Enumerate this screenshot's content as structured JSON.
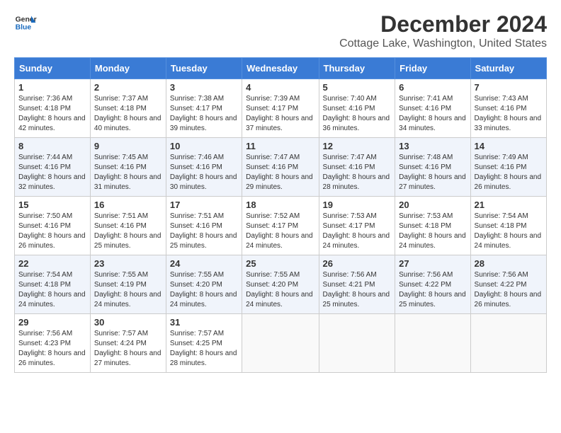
{
  "logo": {
    "line1": "General",
    "line2": "Blue"
  },
  "title": "December 2024",
  "subtitle": "Cottage Lake, Washington, United States",
  "header_color": "#3a7bd5",
  "days": [
    "Sunday",
    "Monday",
    "Tuesday",
    "Wednesday",
    "Thursday",
    "Friday",
    "Saturday"
  ],
  "weeks": [
    [
      {
        "day": "1",
        "sunrise": "7:36 AM",
        "sunset": "4:18 PM",
        "daylight": "8 hours and 42 minutes."
      },
      {
        "day": "2",
        "sunrise": "7:37 AM",
        "sunset": "4:18 PM",
        "daylight": "8 hours and 40 minutes."
      },
      {
        "day": "3",
        "sunrise": "7:38 AM",
        "sunset": "4:17 PM",
        "daylight": "8 hours and 39 minutes."
      },
      {
        "day": "4",
        "sunrise": "7:39 AM",
        "sunset": "4:17 PM",
        "daylight": "8 hours and 37 minutes."
      },
      {
        "day": "5",
        "sunrise": "7:40 AM",
        "sunset": "4:16 PM",
        "daylight": "8 hours and 36 minutes."
      },
      {
        "day": "6",
        "sunrise": "7:41 AM",
        "sunset": "4:16 PM",
        "daylight": "8 hours and 34 minutes."
      },
      {
        "day": "7",
        "sunrise": "7:43 AM",
        "sunset": "4:16 PM",
        "daylight": "8 hours and 33 minutes."
      }
    ],
    [
      {
        "day": "8",
        "sunrise": "7:44 AM",
        "sunset": "4:16 PM",
        "daylight": "8 hours and 32 minutes."
      },
      {
        "day": "9",
        "sunrise": "7:45 AM",
        "sunset": "4:16 PM",
        "daylight": "8 hours and 31 minutes."
      },
      {
        "day": "10",
        "sunrise": "7:46 AM",
        "sunset": "4:16 PM",
        "daylight": "8 hours and 30 minutes."
      },
      {
        "day": "11",
        "sunrise": "7:47 AM",
        "sunset": "4:16 PM",
        "daylight": "8 hours and 29 minutes."
      },
      {
        "day": "12",
        "sunrise": "7:47 AM",
        "sunset": "4:16 PM",
        "daylight": "8 hours and 28 minutes."
      },
      {
        "day": "13",
        "sunrise": "7:48 AM",
        "sunset": "4:16 PM",
        "daylight": "8 hours and 27 minutes."
      },
      {
        "day": "14",
        "sunrise": "7:49 AM",
        "sunset": "4:16 PM",
        "daylight": "8 hours and 26 minutes."
      }
    ],
    [
      {
        "day": "15",
        "sunrise": "7:50 AM",
        "sunset": "4:16 PM",
        "daylight": "8 hours and 26 minutes."
      },
      {
        "day": "16",
        "sunrise": "7:51 AM",
        "sunset": "4:16 PM",
        "daylight": "8 hours and 25 minutes."
      },
      {
        "day": "17",
        "sunrise": "7:51 AM",
        "sunset": "4:16 PM",
        "daylight": "8 hours and 25 minutes."
      },
      {
        "day": "18",
        "sunrise": "7:52 AM",
        "sunset": "4:17 PM",
        "daylight": "8 hours and 24 minutes."
      },
      {
        "day": "19",
        "sunrise": "7:53 AM",
        "sunset": "4:17 PM",
        "daylight": "8 hours and 24 minutes."
      },
      {
        "day": "20",
        "sunrise": "7:53 AM",
        "sunset": "4:18 PM",
        "daylight": "8 hours and 24 minutes."
      },
      {
        "day": "21",
        "sunrise": "7:54 AM",
        "sunset": "4:18 PM",
        "daylight": "8 hours and 24 minutes."
      }
    ],
    [
      {
        "day": "22",
        "sunrise": "7:54 AM",
        "sunset": "4:18 PM",
        "daylight": "8 hours and 24 minutes."
      },
      {
        "day": "23",
        "sunrise": "7:55 AM",
        "sunset": "4:19 PM",
        "daylight": "8 hours and 24 minutes."
      },
      {
        "day": "24",
        "sunrise": "7:55 AM",
        "sunset": "4:20 PM",
        "daylight": "8 hours and 24 minutes."
      },
      {
        "day": "25",
        "sunrise": "7:55 AM",
        "sunset": "4:20 PM",
        "daylight": "8 hours and 24 minutes."
      },
      {
        "day": "26",
        "sunrise": "7:56 AM",
        "sunset": "4:21 PM",
        "daylight": "8 hours and 25 minutes."
      },
      {
        "day": "27",
        "sunrise": "7:56 AM",
        "sunset": "4:22 PM",
        "daylight": "8 hours and 25 minutes."
      },
      {
        "day": "28",
        "sunrise": "7:56 AM",
        "sunset": "4:22 PM",
        "daylight": "8 hours and 26 minutes."
      }
    ],
    [
      {
        "day": "29",
        "sunrise": "7:56 AM",
        "sunset": "4:23 PM",
        "daylight": "8 hours and 26 minutes."
      },
      {
        "day": "30",
        "sunrise": "7:57 AM",
        "sunset": "4:24 PM",
        "daylight": "8 hours and 27 minutes."
      },
      {
        "day": "31",
        "sunrise": "7:57 AM",
        "sunset": "4:25 PM",
        "daylight": "8 hours and 28 minutes."
      },
      null,
      null,
      null,
      null
    ]
  ]
}
